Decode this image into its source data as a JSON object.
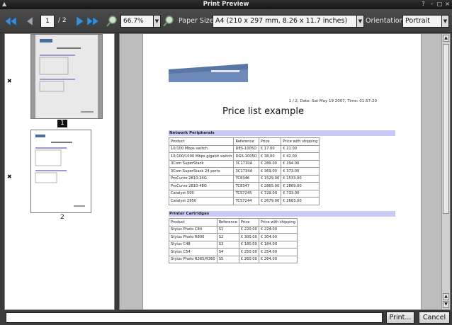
{
  "window": {
    "title": "Print Preview"
  },
  "toolbar": {
    "current_page": "1",
    "total_pages": "/ 2",
    "zoom": "66.7%",
    "paper_size_label": "Paper Size:",
    "paper_size_value": "A4 (210 x 297 mm, 8.26 x 11.7 inches)",
    "orientation_label": "Orientation:",
    "orientation_value": "Portrait"
  },
  "thumbnails": [
    {
      "number": "1",
      "selected": true
    },
    {
      "number": "2",
      "selected": false
    }
  ],
  "document": {
    "page_info": "1 / 2, Date: Sat May 19 2007, Time: 01:57:20",
    "title": "Price list example",
    "sections": [
      {
        "heading": "Network Peripherals",
        "columns": [
          "Product",
          "Reference",
          "Price",
          "Price with shipping"
        ],
        "rows": [
          [
            "10/100 Mbps switch",
            "DES-1005D",
            "€ 17.00",
            "€ 21.00"
          ],
          [
            "10/100/1000 Mbps gigabit switch",
            "DGS-1005D",
            "€ 38.00",
            "€ 42.00"
          ],
          [
            "3Com SuperStack",
            "3C1730A",
            "€ 289.00",
            "€ 294.00"
          ],
          [
            "3Com SuperStack 24 ports",
            "3C1734A",
            "€ 369.00",
            "€ 373.00"
          ],
          [
            "ProCurve 2810-24G",
            "TC8346",
            "€ 1529.00",
            "€ 1533.00"
          ],
          [
            "ProCurve 2810-48G",
            "TC8347",
            "€ 2865.00",
            "€ 2869.00"
          ],
          [
            "Catalyst 500",
            "TC57245",
            "€ 729.00",
            "€ 733.00"
          ],
          [
            "Catalyst 2950",
            "TC57244",
            "€ 2679.00",
            "€ 2683.00"
          ]
        ]
      },
      {
        "heading": "Printer Cartridges",
        "columns": [
          "Product",
          "Reference",
          "Price",
          "Price with shipping"
        ],
        "rows": [
          [
            "Stylus Photo C84",
            "S1",
            "€ 220.00",
            "€ 224.00"
          ],
          [
            "Stylus Photo R800",
            "S2",
            "€ 300.00",
            "€ 304.00"
          ],
          [
            "Stylus C48",
            "S3",
            "€ 180.00",
            "€ 184.00"
          ],
          [
            "Stylus C54",
            "S4",
            "€ 250.00",
            "€ 254.00"
          ],
          [
            "Stylus Photo R365/R360",
            "S5",
            "€ 260.00",
            "€ 264.00"
          ]
        ]
      }
    ]
  },
  "footer": {
    "print_button": "Print...",
    "cancel_button": "Cancel"
  },
  "colors": {
    "section_header_bg": "#c9c9f5",
    "nav_arrow": "#3a8fd8",
    "toolbar_bg": "#444444"
  },
  "icons": {
    "first_page": "double-left-arrow-icon",
    "prev_page": "left-arrow-icon",
    "next_page": "right-arrow-icon",
    "last_page": "double-right-arrow-icon",
    "zoom_out": "zoom-out-icon",
    "zoom_in": "zoom-in-icon"
  }
}
